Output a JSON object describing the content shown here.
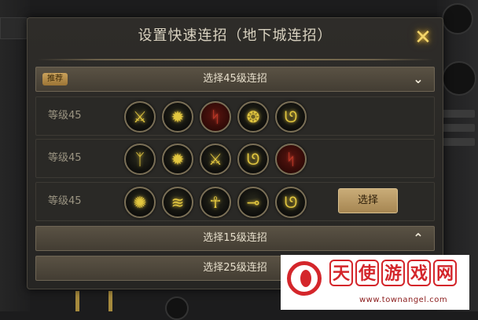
{
  "dialog": {
    "title": "设置快速连招（地下城连招）",
    "close_glyph": "✕"
  },
  "sections": {
    "lv45": {
      "badge": "推荐",
      "label": "选择45级连招",
      "chevron": "⌄"
    },
    "lv15": {
      "label": "选择15级连招",
      "chevron": "⌃"
    },
    "lv25": {
      "label": "选择25级连招"
    }
  },
  "combos": [
    {
      "level_label": "等级45",
      "skills": [
        {
          "icon": "slash-dash-skill-icon",
          "glyph": "⚔",
          "tint": "gold"
        },
        {
          "icon": "star-burst-skill-icon",
          "glyph": "✹",
          "tint": "gold"
        },
        {
          "icon": "flame-dragon-skill-icon",
          "glyph": "ᛋ",
          "tint": "red"
        },
        {
          "icon": "whirl-strike-skill-icon",
          "glyph": "❂",
          "tint": "gold"
        },
        {
          "icon": "spin-blade-skill-icon",
          "glyph": "ᘎ",
          "tint": "gold"
        }
      ]
    },
    {
      "level_label": "等级45",
      "skills": [
        {
          "icon": "kick-skill-icon",
          "glyph": "ᛉ",
          "tint": "gold"
        },
        {
          "icon": "star-burst-skill-icon",
          "glyph": "✹",
          "tint": "gold"
        },
        {
          "icon": "slash-dash-skill-icon",
          "glyph": "⚔",
          "tint": "gold"
        },
        {
          "icon": "spin-blade-skill-icon",
          "glyph": "ᘎ",
          "tint": "gold"
        },
        {
          "icon": "flame-dragon-skill-icon",
          "glyph": "ᛋ",
          "tint": "red"
        }
      ]
    },
    {
      "level_label": "等级45",
      "skills": [
        {
          "icon": "leaf-burst-skill-icon",
          "glyph": "✺",
          "tint": "gold"
        },
        {
          "icon": "wing-slash-skill-icon",
          "glyph": "≋",
          "tint": "gold"
        },
        {
          "icon": "spirit-figure-skill-icon",
          "glyph": "☥",
          "tint": "gold"
        },
        {
          "icon": "hook-grab-skill-icon",
          "glyph": "⊸",
          "tint": "gold"
        },
        {
          "icon": "spin-blade-skill-icon",
          "glyph": "ᘎ",
          "tint": "gold"
        }
      ],
      "select_label": "选择"
    }
  ],
  "watermark": {
    "chars": [
      "天",
      "使",
      "游",
      "戏",
      "网"
    ],
    "url": "www.townangel.com"
  },
  "colors": {
    "accent_gold": "#e2c740",
    "button_gold": "#c9ac78",
    "watermark_red": "#d4262b"
  }
}
